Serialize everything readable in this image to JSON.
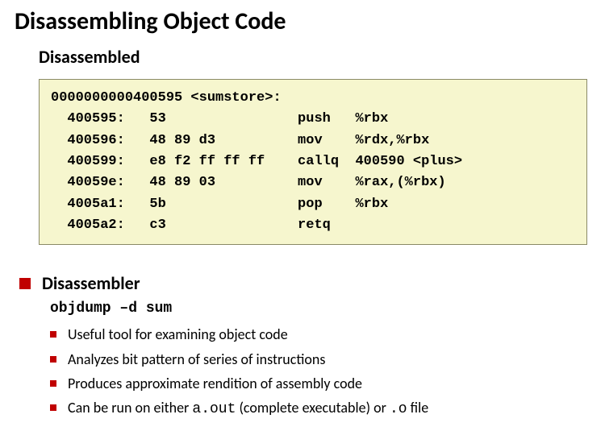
{
  "title": "Disassembling Object Code",
  "disassembled": {
    "heading": "Disassembled",
    "header_line": "0000000000400595 <sumstore>:",
    "rows": [
      {
        "addr": "400595:",
        "bytes": "53",
        "mnem": "push",
        "ops": "%rbx"
      },
      {
        "addr": "400596:",
        "bytes": "48 89 d3",
        "mnem": "mov",
        "ops": "%rdx,%rbx"
      },
      {
        "addr": "400599:",
        "bytes": "e8 f2 ff ff ff",
        "mnem": "callq",
        "ops": "400590 <plus>"
      },
      {
        "addr": "40059e:",
        "bytes": "48 89 03",
        "mnem": "mov",
        "ops": "%rax,(%rbx)"
      },
      {
        "addr": "4005a1:",
        "bytes": "5b",
        "mnem": "pop",
        "ops": "%rbx"
      },
      {
        "addr": "4005a2:",
        "bytes": "c3",
        "mnem": "retq",
        "ops": ""
      }
    ]
  },
  "disassembler": {
    "heading": "Disassembler",
    "command": "objdump –d sum",
    "bullets": [
      {
        "text": "Useful tool for examining object code"
      },
      {
        "text": "Analyzes bit pattern of series of instructions"
      },
      {
        "text": "Produces approximate rendition of assembly code"
      },
      {
        "text_pre": "Can be run on either ",
        "mono1": "a.out",
        "text_mid": " (complete executable) or ",
        "mono2": ".o",
        "text_post": " file"
      }
    ]
  }
}
